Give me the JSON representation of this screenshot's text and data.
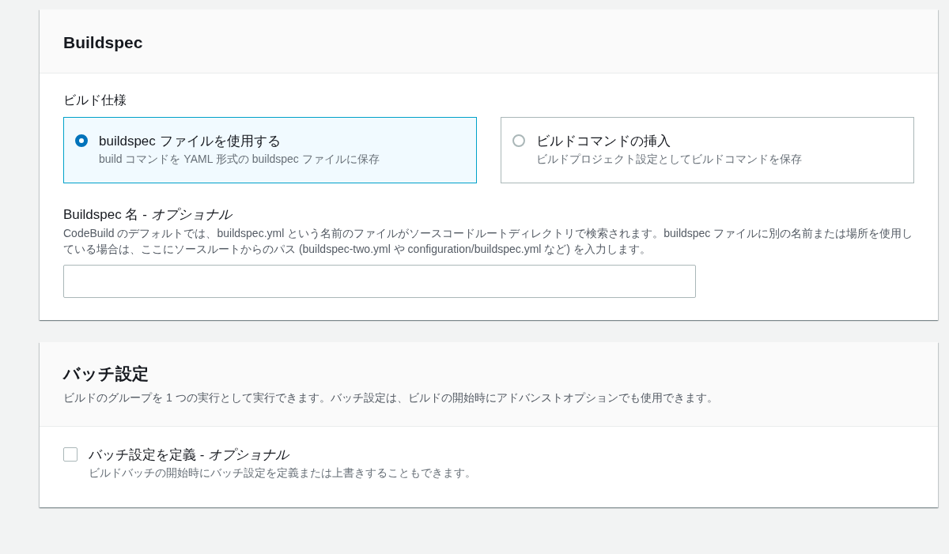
{
  "buildspec_panel": {
    "title": "Buildspec",
    "field_label": "ビルド仕様",
    "options": [
      {
        "label": "buildspec ファイルを使用する",
        "description": "build コマンドを YAML 形式の buildspec ファイルに保存",
        "selected": true
      },
      {
        "label": "ビルドコマンドの挿入",
        "description": "ビルドプロジェクト設定としてビルドコマンドを保存",
        "selected": false
      }
    ],
    "name_field": {
      "label": "Buildspec 名 - *オプショナル*",
      "description": "CodeBuild のデフォルトでは、buildspec.yml という名前のファイルがソースコードルートディレクトリで検索されます。buildspec ファイルに別の名前または場所を使用している場合は、ここにソースルートからのパス (buildspec-two.yml や configuration/buildspec.yml など) を入力します。"
    }
  },
  "batch_panel": {
    "title": "バッチ設定",
    "description": "ビルドのグループを 1 つの実行として実行できます。バッチ設定は、ビルドの開始時にアドバンストオプションでも使用できます。",
    "checkbox": {
      "label": "バッチ設定を定義 - *オプショナル*",
      "description": "ビルドバッチの開始時にバッチ設定を定義または上書きすることもできます。",
      "checked": false
    }
  }
}
